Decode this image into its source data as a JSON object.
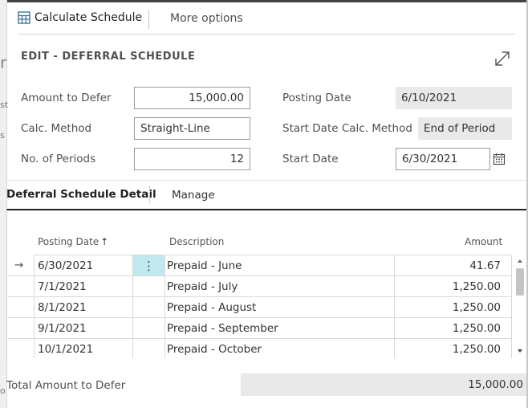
{
  "toolbar": {
    "calculate_label": "Calculate Schedule",
    "more_label": "More options"
  },
  "header": {
    "title": "EDIT - DEFERRAL SCHEDULE"
  },
  "form": {
    "amount_to_defer_label": "Amount to Defer",
    "amount_to_defer_value": "15,000.00",
    "calc_method_label": "Calc. Method",
    "calc_method_value": "Straight-Line",
    "no_of_periods_label": "No. of Periods",
    "no_of_periods_value": "12",
    "posting_date_label": "Posting Date",
    "posting_date_value": "6/10/2021",
    "start_calc_label": "Start Date Calc. Method",
    "start_calc_value": "End of Period",
    "start_date_label": "Start Date",
    "start_date_value": "6/30/2021"
  },
  "detail": {
    "title": "Deferral Schedule Detail",
    "manage_label": "Manage",
    "columns": {
      "posting_date": "Posting Date",
      "sort_glyph": "↑",
      "description": "Description",
      "amount": "Amount"
    },
    "rows": [
      {
        "date": "6/30/2021",
        "description": "Prepaid - June",
        "amount": "41.67"
      },
      {
        "date": "7/1/2021",
        "description": "Prepaid - July",
        "amount": "1,250.00"
      },
      {
        "date": "8/1/2021",
        "description": "Prepaid - August",
        "amount": "1,250.00"
      },
      {
        "date": "9/1/2021",
        "description": "Prepaid - September",
        "amount": "1,250.00"
      },
      {
        "date": "10/1/2021",
        "description": "Prepaid - October",
        "amount": "1,250.00"
      }
    ],
    "row_marker": "→",
    "row_menu": "⋮"
  },
  "footer": {
    "total_label": "Total Amount to Defer",
    "total_value": "15,000.00"
  },
  "background": {
    "letters": [
      "r",
      "st",
      "s",
      "o"
    ]
  },
  "colors": {
    "selected_cell": "#bfe9ee",
    "accent_icon": "#2f6f8f"
  }
}
